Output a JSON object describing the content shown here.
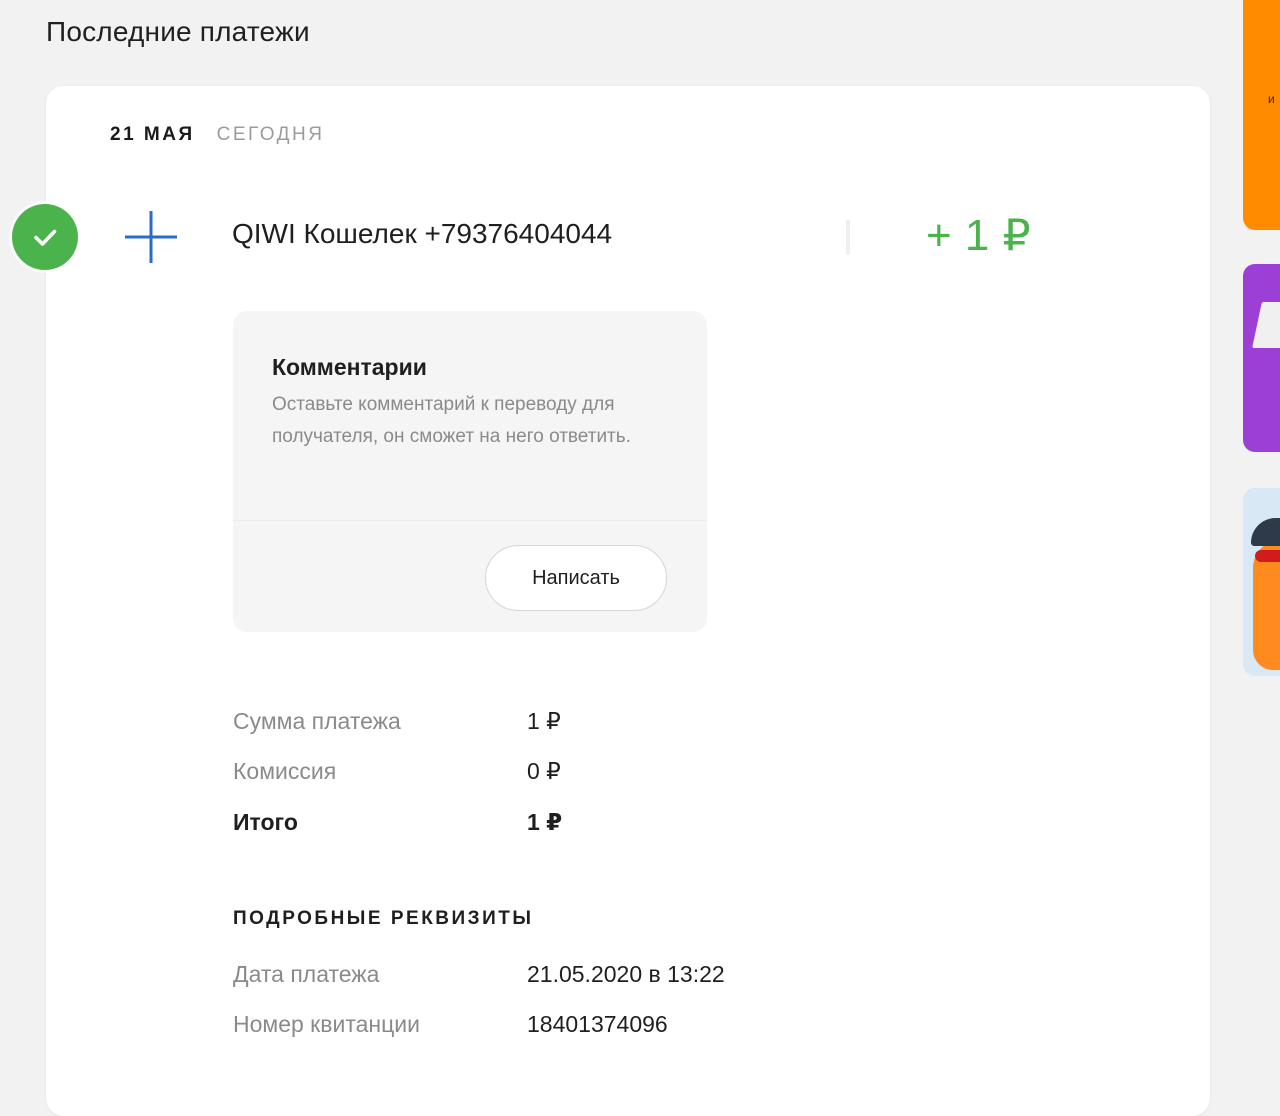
{
  "section": {
    "title": "Последние платежи"
  },
  "payment": {
    "date": "21 мая",
    "relative_date": "сегодня",
    "payee": "QIWI Кошелек +79376404044",
    "amount": "+ 1 ₽",
    "status": "success",
    "colors": {
      "success": "#4bb34b",
      "plus_icon": "#2b6cc4"
    }
  },
  "comments": {
    "title": "Комментарии",
    "text": "Оставьте комментарий к переводу для получателя, он сможет на него ответить.",
    "button_label": "Написать"
  },
  "summary": [
    {
      "label": "Сумма платежа",
      "value": "1 ₽"
    },
    {
      "label": "Комиссия",
      "value": "0 ₽"
    },
    {
      "label": "Итого",
      "value": "1 ₽"
    }
  ],
  "details": {
    "title": "Подробные реквизиты",
    "rows": [
      {
        "label": "Дата платежа",
        "value": "21.05.2020 в 13:22"
      },
      {
        "label": "Номер квитанции",
        "value": "18401374096"
      }
    ]
  },
  "banners": {
    "orange_letter": "и",
    "colors": [
      "#ff8c00",
      "#9b3fd6",
      "#d9e8f5"
    ]
  }
}
